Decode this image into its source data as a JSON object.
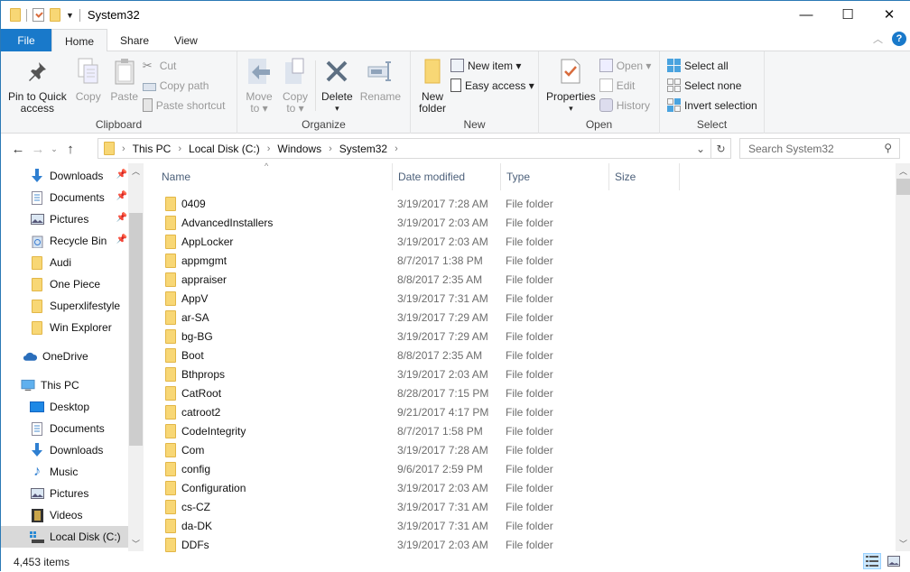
{
  "window": {
    "title": "System32",
    "controls": {
      "minimize": "—",
      "maximize": "☐",
      "close": "✕"
    }
  },
  "ribbon_tabs": [
    {
      "label": "File"
    },
    {
      "label": "Home",
      "active": true
    },
    {
      "label": "Share"
    },
    {
      "label": "View"
    }
  ],
  "ribbon": {
    "clipboard": {
      "label": "Clipboard",
      "pin": "Pin to Quick access",
      "pin_l1": "Pin to Quick",
      "pin_l2": "access",
      "copy": "Copy",
      "paste": "Paste",
      "cut": "Cut",
      "copy_path": "Copy path",
      "paste_shortcut": "Paste shortcut"
    },
    "organize": {
      "label": "Organize",
      "move_l1": "Move",
      "move_l2": "to ▾",
      "copy_l1": "Copy",
      "copy_l2": "to ▾",
      "delete": "Delete",
      "delete_drop": "▾",
      "rename": "Rename"
    },
    "new": {
      "label": "New",
      "new_folder_l1": "New",
      "new_folder_l2": "folder",
      "new_item": "New item ▾",
      "easy_access": "Easy access ▾"
    },
    "open": {
      "label": "Open",
      "properties": "Properties",
      "properties_drop": "▾",
      "open": "Open ▾",
      "edit": "Edit",
      "history": "History"
    },
    "select": {
      "label": "Select",
      "select_all": "Select all",
      "select_none": "Select none",
      "invert": "Invert selection"
    }
  },
  "address": {
    "crumbs": [
      "This PC",
      "Local Disk (C:)",
      "Windows",
      "System32"
    ],
    "search_placeholder": "Search System32"
  },
  "nav_pane": {
    "quick_access": [
      {
        "label": "Downloads",
        "icon": "download-icon",
        "pinned": true
      },
      {
        "label": "Documents",
        "icon": "documents-icon",
        "pinned": true
      },
      {
        "label": "Pictures",
        "icon": "pictures-icon",
        "pinned": true
      },
      {
        "label": "Recycle Bin",
        "icon": "recycle-bin-icon",
        "pinned": true
      },
      {
        "label": "Audi",
        "icon": "folder-icon"
      },
      {
        "label": "One Piece",
        "icon": "folder-icon"
      },
      {
        "label": "Superxlifestyle",
        "icon": "folder-icon"
      },
      {
        "label": "Win Explorer",
        "icon": "folder-icon"
      }
    ],
    "onedrive": "OneDrive",
    "this_pc": "This PC",
    "this_pc_items": [
      {
        "label": "Desktop",
        "icon": "desktop-icon"
      },
      {
        "label": "Documents",
        "icon": "documents-icon"
      },
      {
        "label": "Downloads",
        "icon": "download-icon"
      },
      {
        "label": "Music",
        "icon": "music-icon"
      },
      {
        "label": "Pictures",
        "icon": "pictures-icon"
      },
      {
        "label": "Videos",
        "icon": "videos-icon"
      },
      {
        "label": "Local Disk (C:)",
        "icon": "drive-icon",
        "selected": true
      }
    ]
  },
  "columns": [
    "Name",
    "Date modified",
    "Type",
    "Size"
  ],
  "files": [
    {
      "name": "0409",
      "date": "3/19/2017 7:28 AM",
      "type": "File folder"
    },
    {
      "name": "AdvancedInstallers",
      "date": "3/19/2017 2:03 AM",
      "type": "File folder"
    },
    {
      "name": "AppLocker",
      "date": "3/19/2017 2:03 AM",
      "type": "File folder"
    },
    {
      "name": "appmgmt",
      "date": "8/7/2017 1:38 PM",
      "type": "File folder"
    },
    {
      "name": "appraiser",
      "date": "8/8/2017 2:35 AM",
      "type": "File folder"
    },
    {
      "name": "AppV",
      "date": "3/19/2017 7:31 AM",
      "type": "File folder"
    },
    {
      "name": "ar-SA",
      "date": "3/19/2017 7:29 AM",
      "type": "File folder"
    },
    {
      "name": "bg-BG",
      "date": "3/19/2017 7:29 AM",
      "type": "File folder"
    },
    {
      "name": "Boot",
      "date": "8/8/2017 2:35 AM",
      "type": "File folder"
    },
    {
      "name": "Bthprops",
      "date": "3/19/2017 2:03 AM",
      "type": "File folder"
    },
    {
      "name": "CatRoot",
      "date": "8/28/2017 7:15 PM",
      "type": "File folder"
    },
    {
      "name": "catroot2",
      "date": "9/21/2017 4:17 PM",
      "type": "File folder"
    },
    {
      "name": "CodeIntegrity",
      "date": "8/7/2017 1:58 PM",
      "type": "File folder"
    },
    {
      "name": "Com",
      "date": "3/19/2017 7:28 AM",
      "type": "File folder"
    },
    {
      "name": "config",
      "date": "9/6/2017 2:59 PM",
      "type": "File folder"
    },
    {
      "name": "Configuration",
      "date": "3/19/2017 2:03 AM",
      "type": "File folder"
    },
    {
      "name": "cs-CZ",
      "date": "3/19/2017 7:31 AM",
      "type": "File folder"
    },
    {
      "name": "da-DK",
      "date": "3/19/2017 7:31 AM",
      "type": "File folder"
    },
    {
      "name": "DDFs",
      "date": "3/19/2017 2:03 AM",
      "type": "File folder"
    }
  ],
  "status": {
    "item_count": "4,453 items"
  },
  "colors": {
    "accent": "#1979ca",
    "folder": "#f8d775",
    "selected_nav": "#d9d9d9"
  }
}
